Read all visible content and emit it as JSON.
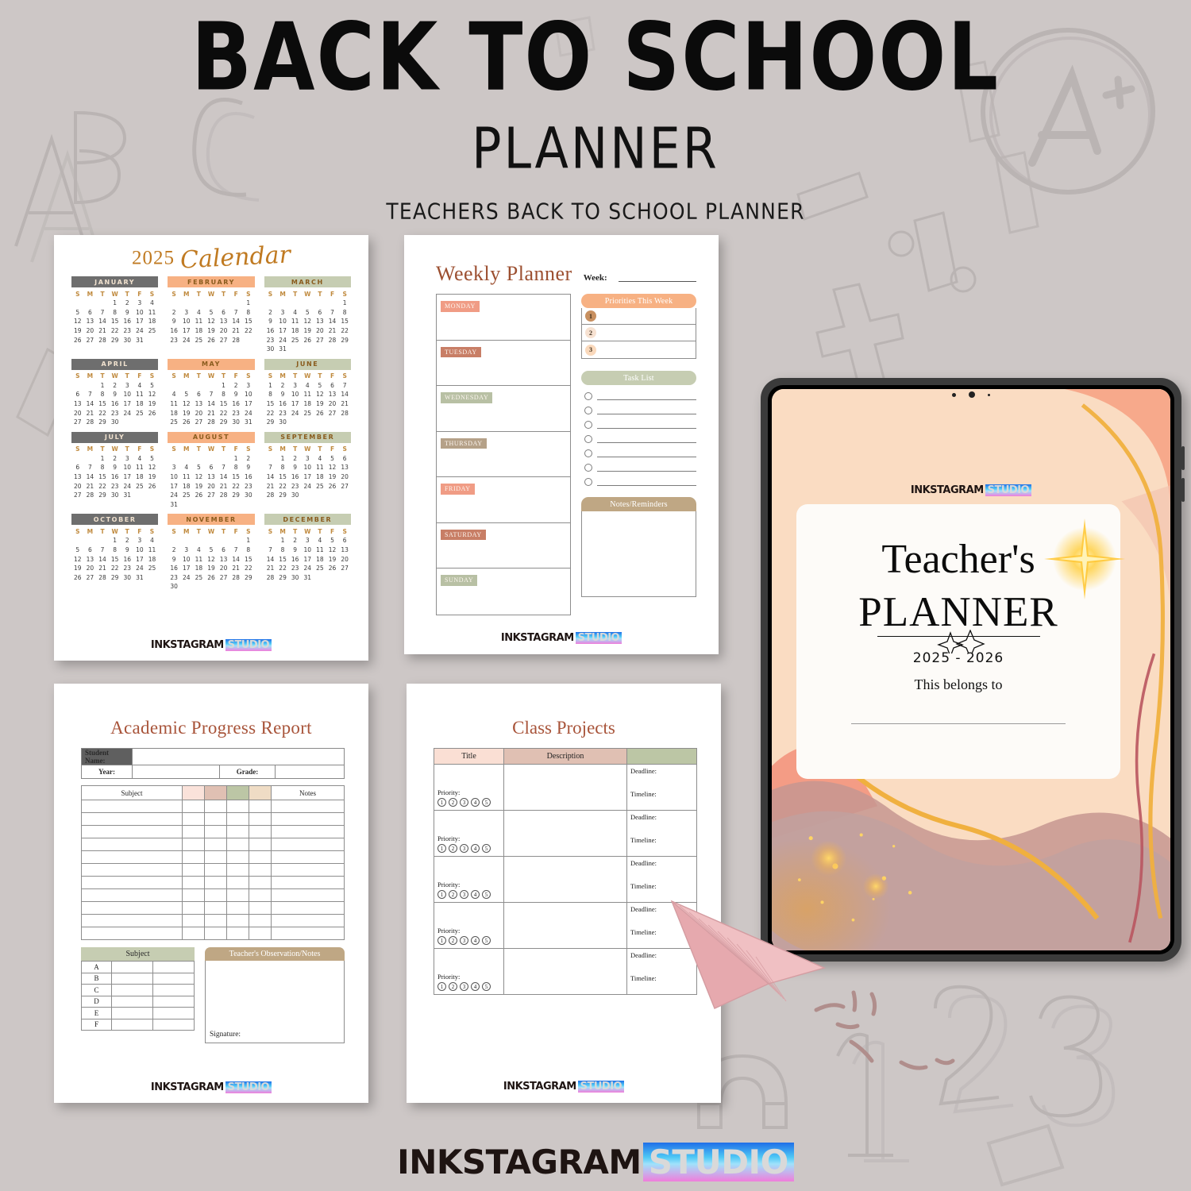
{
  "header": {
    "title": "BACK TO SCHOOL",
    "subtitle": "PLANNER",
    "tagline": "TEACHERS BACK TO SCHOOL PLANNER"
  },
  "brand": {
    "part1": "INKSTAGRAM",
    "part2": "STUDIO"
  },
  "colors": {
    "background": "#cdc7c6",
    "gray_header": "#6e6e6e",
    "peach_header": "#f7b183",
    "sage_header": "#c6cdb2",
    "accent_brown": "#c07a21",
    "title_rust": "#a8543a",
    "tan": "#bfa784"
  },
  "calendar_page": {
    "year": "2025",
    "word": "Calendar",
    "weekday_initials": [
      "S",
      "M",
      "T",
      "W",
      "T",
      "F",
      "S"
    ],
    "months": [
      {
        "name": "JANUARY",
        "style": "m-gray",
        "start": 3,
        "days": 31
      },
      {
        "name": "FEBRUARY",
        "style": "m-peach",
        "start": 6,
        "days": 28
      },
      {
        "name": "MARCH",
        "style": "m-sage",
        "start": 6,
        "days": 31
      },
      {
        "name": "APRIL",
        "style": "m-gray",
        "start": 2,
        "days": 30
      },
      {
        "name": "MAY",
        "style": "m-peach",
        "start": 4,
        "days": 31
      },
      {
        "name": "JUNE",
        "style": "m-sage",
        "start": 0,
        "days": 30
      },
      {
        "name": "JULY",
        "style": "m-gray",
        "start": 2,
        "days": 31
      },
      {
        "name": "AUGUST",
        "style": "m-peach",
        "start": 5,
        "days": 31
      },
      {
        "name": "SEPTEMBER",
        "style": "m-sage",
        "start": 1,
        "days": 30
      },
      {
        "name": "OCTOBER",
        "style": "m-gray",
        "start": 3,
        "days": 31
      },
      {
        "name": "NOVEMBER",
        "style": "m-peach",
        "start": 6,
        "days": 30
      },
      {
        "name": "DECEMBER",
        "style": "m-sage",
        "start": 1,
        "days": 31
      }
    ]
  },
  "weekly_page": {
    "title": "Weekly Planner",
    "week_label": "Week:",
    "days": [
      {
        "name": "MONDAY",
        "color": "#f09c85"
      },
      {
        "name": "TUESDAY",
        "color": "#c87e66"
      },
      {
        "name": "WEDNESDAY",
        "color": "#b8c0a4"
      },
      {
        "name": "THURSDAY",
        "color": "#b5a188"
      },
      {
        "name": "FRIDAY",
        "color": "#f09c85"
      },
      {
        "name": "SATURDAY",
        "color": "#c87e66"
      },
      {
        "name": "SUNDAY",
        "color": "#b8c0a4"
      }
    ],
    "priorities": {
      "heading": "Priorities This Week",
      "heading_color": "#f7b183",
      "rows": [
        {
          "num": "1",
          "badge_color": "#c89060"
        },
        {
          "num": "2",
          "badge_color": "#f7e2d2"
        },
        {
          "num": "3",
          "badge_color": "#fad9bc"
        }
      ]
    },
    "task_list": {
      "heading": "Task List",
      "heading_color": "#c6cdb2",
      "count": 7
    },
    "notes": {
      "heading": "Notes/Reminders",
      "heading_color": "#bfa784"
    }
  },
  "academic_page": {
    "title": "Academic Progress Report",
    "info": {
      "student_name_label": "Student Name:",
      "year_label": "Year:",
      "grade_label": "Grade:"
    },
    "subject_table": {
      "col_subject": "Subject",
      "col_notes": "Notes",
      "swatches": [
        "#fae2da",
        "#e0c0b3",
        "#bcc6a5",
        "#efdcc5"
      ],
      "row_count": 11
    },
    "grade_table": {
      "header": "Subject",
      "rows": [
        "A",
        "B",
        "C",
        "D",
        "E",
        "F"
      ]
    },
    "observation": {
      "heading": "Teacher's Observation/Notes",
      "signature_label": "Signature:"
    }
  },
  "projects_page": {
    "title": "Class Projects",
    "columns": {
      "title": "Title",
      "description": "Description",
      "deadline": ""
    },
    "priority_label": "Priority:",
    "priority_options": [
      "1",
      "2",
      "3",
      "4",
      "5"
    ],
    "deadline_label": "Deadline:",
    "timeline_label": "Timeline:",
    "row_count": 5
  },
  "tablet": {
    "cover": {
      "line1": "Teacher's",
      "line2": "PLANNER",
      "years": "2025 - 2026",
      "belongs": "This belongs to"
    }
  },
  "doodles": {
    "abc": "ABC",
    "a_plus": "A+",
    "numbers": "123",
    "symbols": [
      "%",
      "÷",
      "+",
      "×",
      "="
    ]
  }
}
